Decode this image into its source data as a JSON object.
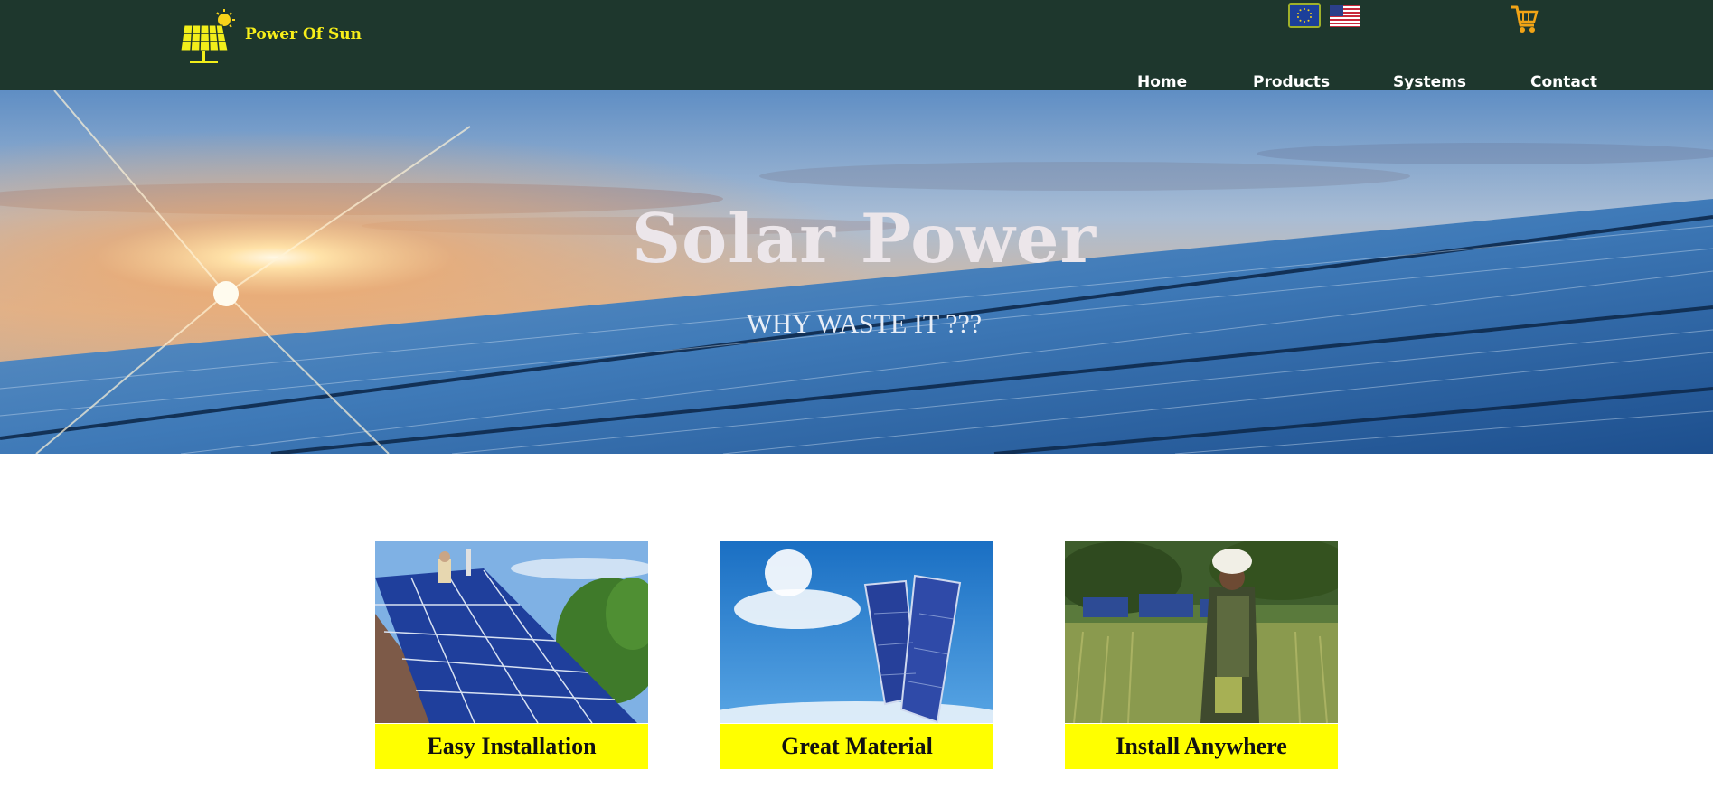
{
  "header": {
    "brand": "Power Of Sun",
    "languages": [
      {
        "icon": "eu-flag-icon",
        "selected": true
      },
      {
        "icon": "us-flag-icon",
        "selected": false
      }
    ],
    "cart_icon": "shopping-cart-icon",
    "nav": [
      {
        "label": "Home"
      },
      {
        "label": "Products"
      },
      {
        "label": "Systems"
      },
      {
        "label": "Contact"
      }
    ]
  },
  "hero": {
    "title": "Solar Power",
    "subtitle": "WHY WASTE IT ???"
  },
  "features": [
    {
      "caption": "Easy Installation",
      "image": "rooftop-installer-photo"
    },
    {
      "caption": "Great Material",
      "image": "panels-in-sky-photo"
    },
    {
      "caption": "Install Anywhere",
      "image": "farmer-field-photo"
    }
  ],
  "colors": {
    "header_bg": "#1e372d",
    "brand_yellow": "#f7ee1a",
    "caption_bg": "#ffff00",
    "cart_orange": "#f2a416"
  }
}
